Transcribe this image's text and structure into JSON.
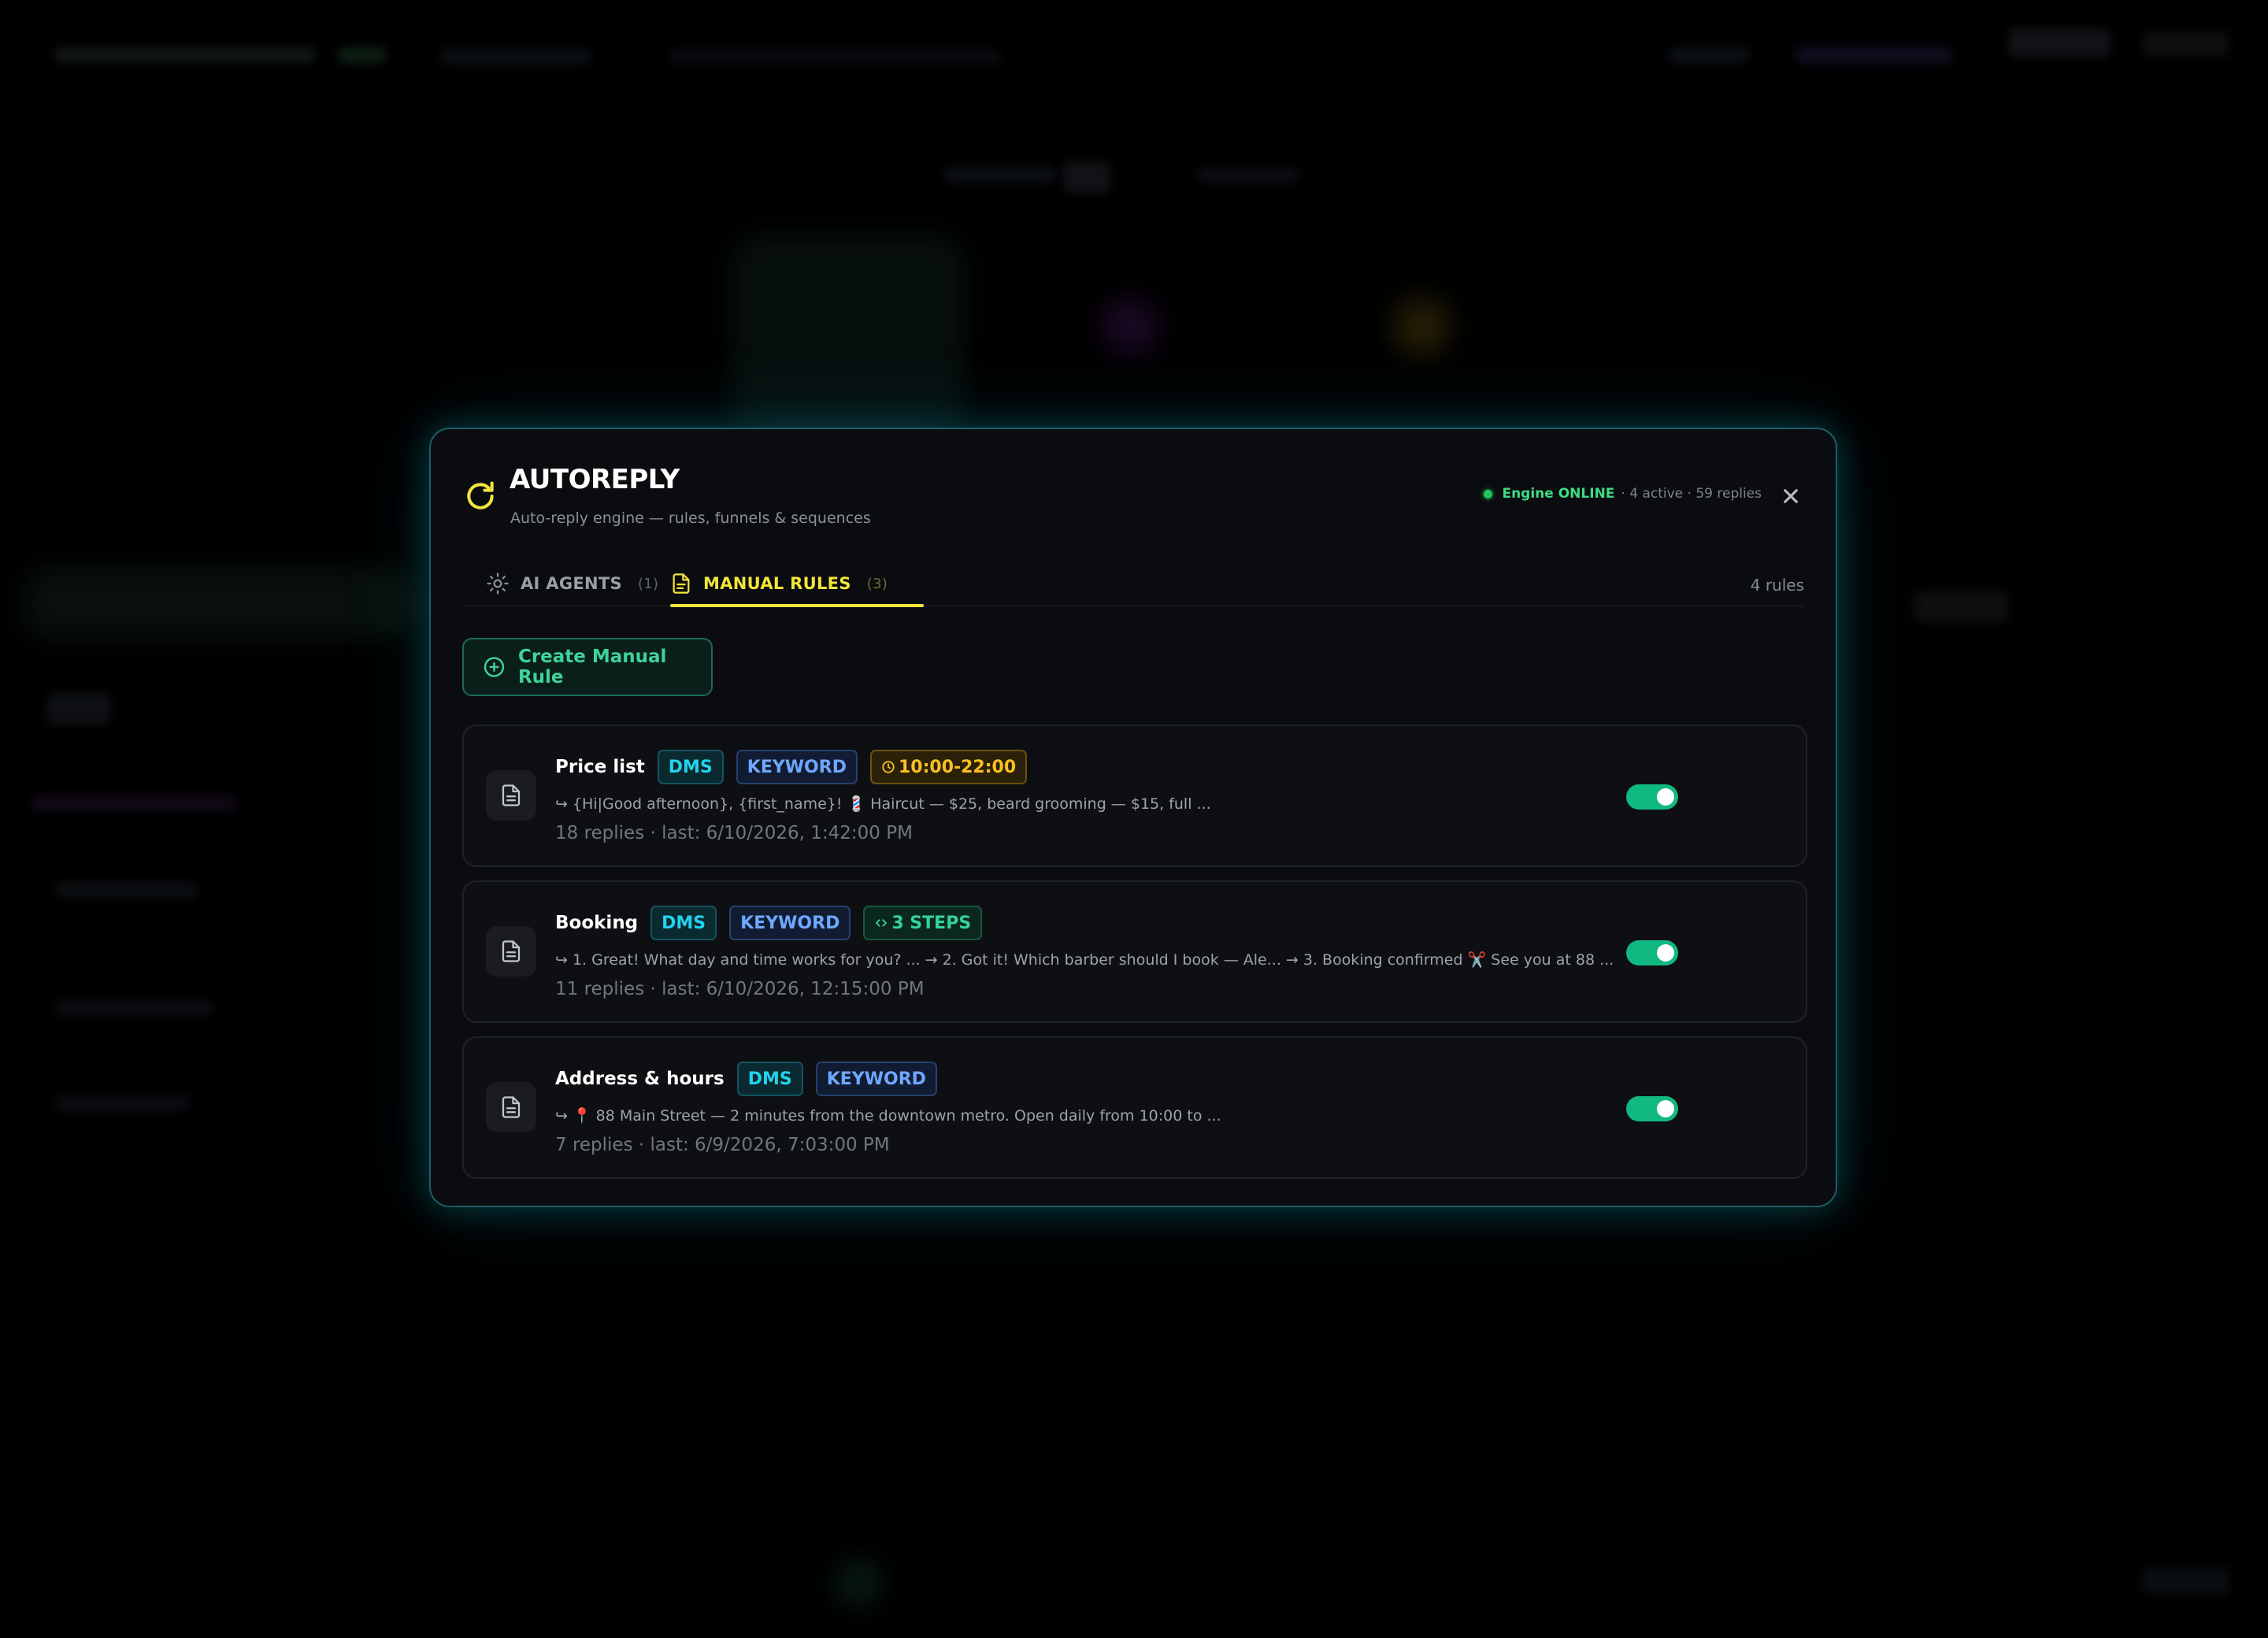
{
  "modal": {
    "title": "AUTOREPLY",
    "subtitle": "Auto-reply engine — rules, funnels & sequences",
    "status": {
      "online_label": "Engine ONLINE",
      "summary": "· 4 active · 59 replies"
    },
    "icons": {
      "header": "refresh-icon",
      "close": "close-icon"
    }
  },
  "tabs": [
    {
      "label": "AI AGENTS",
      "count": "(1)",
      "icon": "sun-icon",
      "active": false
    },
    {
      "label": "MANUAL RULES",
      "count": "(3)",
      "icon": "document-icon",
      "active": true
    }
  ],
  "rules_count": "4 rules",
  "create_button": {
    "label": "Create Manual Rule",
    "icon": "plus-circle-icon"
  },
  "rules": [
    {
      "name": "Price list",
      "tags": [
        "DMS",
        "KEYWORD"
      ],
      "extra_tag": "10:00-22:00",
      "preview": "↪ {Hi|Good afternoon}, {first_name}! 💈 Haircut — $25, beard grooming — $15, full ...",
      "meta": "18 replies · last: 6/10/2026, 1:42:00 PM",
      "enabled": true
    },
    {
      "name": "Booking",
      "tags": [
        "DMS",
        "KEYWORD"
      ],
      "extra_tag": "3 STEPS",
      "preview": "↪ 1. Great! What day and time works for you? ... → 2. Got it! Which barber should I book — Ale... → 3. Booking confirmed ✂️ See you at 88 ...",
      "meta": "11 replies · last: 6/10/2026, 12:15:00 PM",
      "enabled": true
    },
    {
      "name": "Address & hours",
      "tags": [
        "DMS",
        "KEYWORD"
      ],
      "preview": "↪ 📍 88 Main Street — 2 minutes from the downtown metro. Open daily from 10:00 to ...",
      "meta": "7 replies · last: 6/9/2026, 7:03:00 PM",
      "enabled": true
    }
  ],
  "colors": {
    "accent_yellow": "#f2e53b",
    "online_green": "#3ddc84",
    "toggle_on": "#10b981",
    "modal_border": "#1c5e66"
  }
}
